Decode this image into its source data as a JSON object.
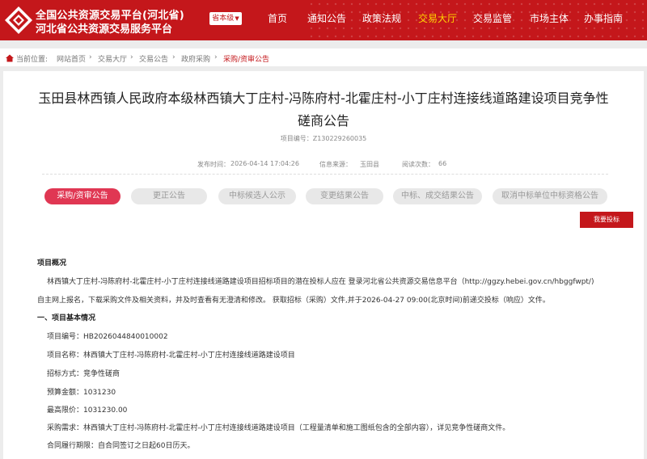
{
  "header": {
    "brand_line1": "全国公共资源交易平台(河北省)",
    "brand_line2": "河北省公共资源交易服务平台",
    "province_select": "省本级",
    "nav": [
      {
        "label": "首页"
      },
      {
        "label": "通知公告"
      },
      {
        "label": "政策法规"
      },
      {
        "label": "交易大厅"
      },
      {
        "label": "交易监管"
      },
      {
        "label": "市场主体"
      },
      {
        "label": "办事指南"
      }
    ],
    "colors": {
      "brand": "#c4171b",
      "nav_active": "#ffd200"
    }
  },
  "breadcrumb": {
    "prefix": "当前位置:",
    "items": [
      "网站首页",
      "交易大厅",
      "交易公告",
      "政府采购",
      "采购/资审公告"
    ]
  },
  "article": {
    "title_line1": "玉田县林西镇人民政府本级林西镇大丁庄村-冯陈府村-北霍庄村-小丁庄村连接线道路建设项目竞争性",
    "title_line2": "磋商公告",
    "project_no": "项目编号：Z130229260035",
    "publish_time_label": "发布时间：",
    "publish_time": "2026-04-14 17:04:26",
    "source_label": "信息来源：",
    "source": "玉田县",
    "views_label": "阅读次数：",
    "views": "66"
  },
  "tabs": [
    {
      "label": "采购/资审公告",
      "active": true
    },
    {
      "label": "更正公告",
      "active": false
    },
    {
      "label": "中标候选人公示",
      "active": false
    },
    {
      "label": "变更结果公告",
      "active": false
    },
    {
      "label": "中标、成交结果公告",
      "active": false
    },
    {
      "label": "取消中标单位中标资格公告",
      "active": false
    }
  ],
  "bid_button": "我要投标",
  "content": {
    "overview_heading": "项目概况",
    "overview_line1": "林西镇大丁庄村-冯陈府村-北霍庄村-小丁庄村连接线道路建设项目招标项目的潜在投标人应在 登录河北省公共资源交易信息平台（http://ggzy.hebei.gov.cn/hbggfwpt/)",
    "overview_line2": "自主网上报名，下载采购文件及相关资料，并及时查看有无澄清和修改。 获取招标（采购）文件,并于2026-04-27 09:00(北京时间)前递交投标（响应）文件。",
    "section1_heading": "一、项目基本情况",
    "items": [
      "项目编号：HB2026044840010002",
      "项目名称：林西镇大丁庄村-冯陈府村-北霍庄村-小丁庄村连接线道路建设项目",
      "招标方式：竞争性磋商",
      "预算金额：1031230",
      "最高限价：1031230.00",
      "采购需求：林西镇大丁庄村-冯陈府村-北霍庄村-小丁庄村连接线道路建设项目（工程量清单和施工图纸包含的全部内容），详见竞争性磋商文件。",
      "合同履行期限：自合同签订之日起60日历天。"
    ]
  }
}
